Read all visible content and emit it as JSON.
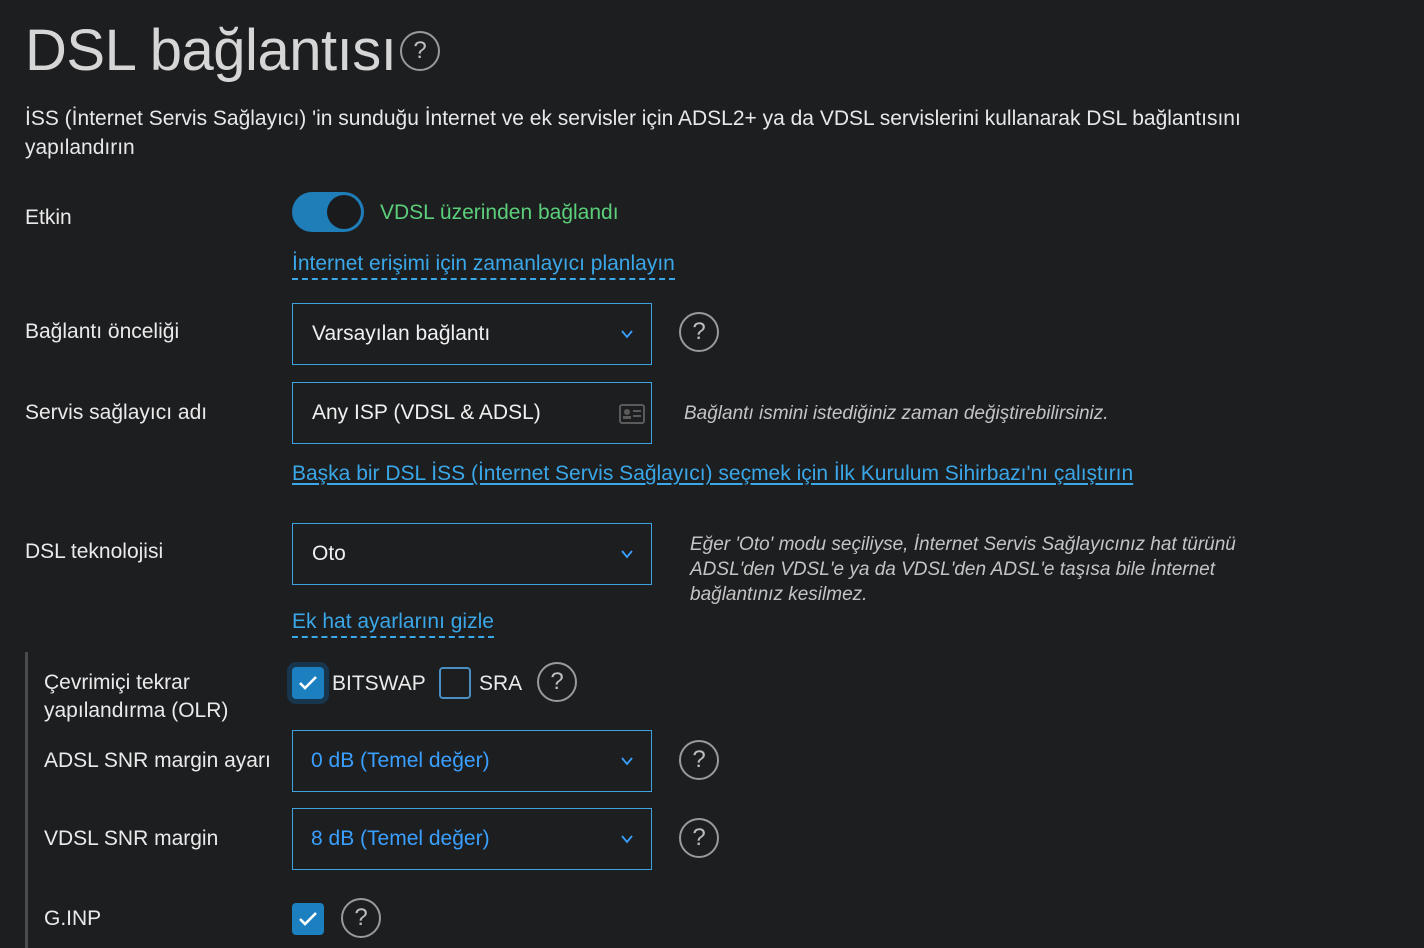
{
  "page": {
    "title": "DSL bağlantısı",
    "description": "İSS (İnternet Servis Sağlayıcı) 'in sunduğu İnternet ve ek servisler için ADSL2+ ya da VDSL servislerini kullanarak DSL bağlantısını yapılandırın",
    "help_glyph": "?"
  },
  "enabled": {
    "label": "Etkin",
    "toggle_on": true,
    "status": "VDSL üzerinden bağlandı",
    "schedule_link": "İnternet erişimi için zamanlayıcı planlayın"
  },
  "priority": {
    "label": "Bağlantı önceliği",
    "value": "Varsayılan bağlantı"
  },
  "provider": {
    "label": "Servis sağlayıcı adı",
    "value": "Any ISP (VDSL & ADSL)",
    "hint": "Bağlantı ismini istediğiniz zaman değiştirebilirsiniz.",
    "wizard_link": "Başka bir DSL İSS (İnternet Servis Sağlayıcı) seçmek için İlk Kurulum Sihirbazı'nı çalıştırın"
  },
  "technology": {
    "label": "DSL teknolojisi",
    "value": "Oto",
    "hint": "Eğer 'Oto' modu seçiliyse, İnternet Servis Sağlayıcınız hat türünü ADSL'den VDSL'e ya da VDSL'den ADSL'e taşısa bile İnternet bağlantınız kesilmez.",
    "extra_link": "Ek hat ayarlarını gizle"
  },
  "olr": {
    "label": "Çevrimiçi tekrar yapılandırma (OLR)",
    "bitswap_label": "BITSWAP",
    "bitswap_checked": true,
    "sra_label": "SRA",
    "sra_checked": false
  },
  "adsl_snr": {
    "label": "ADSL SNR margin ayarı",
    "value": "0 dB (Temel değer)"
  },
  "vdsl_snr": {
    "label": "VDSL SNR margin",
    "value": "8 dB (Temel değer)"
  },
  "ginp": {
    "label": "G.INP",
    "checked": true
  },
  "colors": {
    "accent": "#1b7fc0",
    "link": "#3aa7e8",
    "status_ok": "#5bcf7a",
    "value_blue": "#3aa0ff",
    "background": "#1d1e20"
  }
}
